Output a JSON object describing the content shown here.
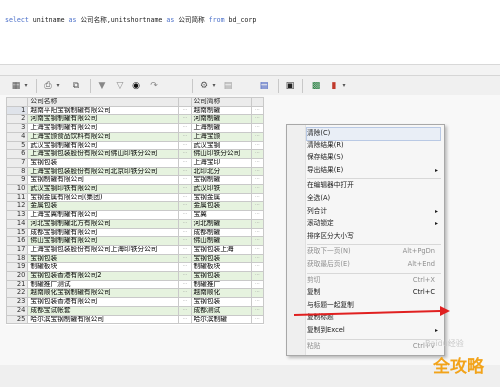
{
  "sql": {
    "select_kw": "select",
    "fields": " unitname ",
    "as1": "as",
    "alias1": " 公司名称,unitshortname ",
    "as2": "as",
    "alias2": " 公司简称 ",
    "from_kw": "from",
    "table": " bd_corp"
  },
  "toolbar": {
    "icons": [
      "grid-layout-icon",
      "dropdown-arrow-icon",
      "print-icon",
      "dropdown-arrow-icon",
      "copy-icon",
      "filter-icon",
      "filter-clear-icon",
      "find-icon",
      "next-icon",
      "sort-icon",
      "dropdown-arrow-icon",
      "chart-icon",
      "save-icon",
      "export-icon",
      "report-icon",
      "dropdown-arrow-icon"
    ]
  },
  "grid": {
    "columns": [
      "公司名称",
      "公司简称"
    ],
    "rows": [
      {
        "n": "1",
        "name": "越南平阳宝钢制罐有限公司",
        "short": "越南制罐"
      },
      {
        "n": "2",
        "name": "河南宝钢制罐有限公司",
        "short": "河南制罐"
      },
      {
        "n": "3",
        "name": "上海宝钢制罐有限公司",
        "short": "上海制罐"
      },
      {
        "n": "4",
        "name": "上海宝颁食品饮料有限公司",
        "short": "上海宝颁"
      },
      {
        "n": "5",
        "name": "武汉宝钢制罐有限公司",
        "short": "武汉宝钢"
      },
      {
        "n": "6",
        "name": "上海宝钢包装股份有限公司佛山印铁分公司",
        "short": "佛山印铁分公司"
      },
      {
        "n": "7",
        "name": "宝钢包装",
        "short": "上海宝印"
      },
      {
        "n": "8",
        "name": "上海宝钢包装股份有限公司北京印铁分公司",
        "short": "北印北分"
      },
      {
        "n": "9",
        "name": "宝钢制罐有限公司",
        "short": "宝钢制罐"
      },
      {
        "n": "10",
        "name": "武汉宝钢印铁有限公司",
        "short": "武汉印铁"
      },
      {
        "n": "11",
        "name": "宝钢金属有限公司(集团)",
        "short": "宝钢金属"
      },
      {
        "n": "12",
        "name": "金属包装",
        "short": "金属包装"
      },
      {
        "n": "13",
        "name": "上海宝翼制罐有限公司",
        "short": "宝翼"
      },
      {
        "n": "14",
        "name": "河北宝钢制罐北方有限公司",
        "short": "河北制罐"
      },
      {
        "n": "15",
        "name": "成都宝钢制罐有限公司",
        "short": "成都制罐"
      },
      {
        "n": "16",
        "name": "佛山宝钢制罐有限公司",
        "short": "佛山制罐"
      },
      {
        "n": "17",
        "name": "上海宝钢包装股份有限公司上海印铁分公司",
        "short": "宝钢包装上海"
      },
      {
        "n": "18",
        "name": "宝钢包装",
        "short": "宝钢包装"
      },
      {
        "n": "19",
        "name": "制罐板块",
        "short": "制罐板块"
      },
      {
        "n": "20",
        "name": "宝钢包装香港有限公司2",
        "short": "宝钢包装"
      },
      {
        "n": "21",
        "name": "制罐推广测试",
        "short": "制罐推广"
      },
      {
        "n": "22",
        "name": "越南顺化宝钢制罐有限公司",
        "short": "越南顺化"
      },
      {
        "n": "23",
        "name": "宝钢包装香港有限公司",
        "short": "宝钢包装"
      },
      {
        "n": "24",
        "name": "成都宝试帐套",
        "short": "成都测试"
      },
      {
        "n": "25",
        "name": "哈尔滨宝钢制罐有限公司",
        "short": "哈尔滨制罐"
      }
    ]
  },
  "context_menu": {
    "items": [
      {
        "label": "清除(C)",
        "shortcut": "",
        "arrow": false,
        "disabled": false,
        "highlight": true
      },
      {
        "label": "清除结果(R)",
        "shortcut": "",
        "arrow": false,
        "disabled": false
      },
      {
        "label": "保存结果(S)",
        "shortcut": "",
        "arrow": false,
        "disabled": false
      },
      {
        "label": "导出结果(E)",
        "shortcut": "",
        "arrow": true,
        "disabled": false
      },
      {
        "label": "在编辑器中打开",
        "shortcut": "",
        "arrow": false,
        "disabled": false
      },
      {
        "label": "全选(A)",
        "shortcut": "",
        "arrow": false,
        "disabled": false
      },
      {
        "label": "列合计",
        "shortcut": "",
        "arrow": true,
        "disabled": false
      },
      {
        "label": "滚动锁定",
        "shortcut": "",
        "arrow": true,
        "disabled": false
      },
      {
        "label": "排序区分大小写",
        "shortcut": "",
        "arrow": false,
        "disabled": false
      },
      {
        "label": "获取下一页(N)",
        "shortcut": "Alt+PgDn",
        "arrow": false,
        "disabled": true
      },
      {
        "label": "获取最后页(E)",
        "shortcut": "Alt+End",
        "arrow": false,
        "disabled": true
      },
      {
        "label": "剪切",
        "shortcut": "Ctrl+X",
        "arrow": false,
        "disabled": true
      },
      {
        "label": "复制",
        "shortcut": "Ctrl+C",
        "arrow": false,
        "disabled": false
      },
      {
        "label": "与标题一起复制",
        "shortcut": "",
        "arrow": false,
        "disabled": false
      },
      {
        "label": "复制标题",
        "shortcut": "",
        "arrow": false,
        "disabled": false
      },
      {
        "label": "复制到Excel",
        "shortcut": "",
        "arrow": true,
        "disabled": false
      },
      {
        "label": "粘贴",
        "shortcut": "Ctrl+V",
        "arrow": false,
        "disabled": true
      }
    ]
  },
  "watermark": {
    "text": "Baidu经验",
    "site": "jingyan.baidu.com",
    "logo": "全攻略"
  },
  "colors": {
    "accent_arrow": "#e02020",
    "row_alt": "#e6f3df",
    "menu_highlight": "#e9eef6"
  }
}
